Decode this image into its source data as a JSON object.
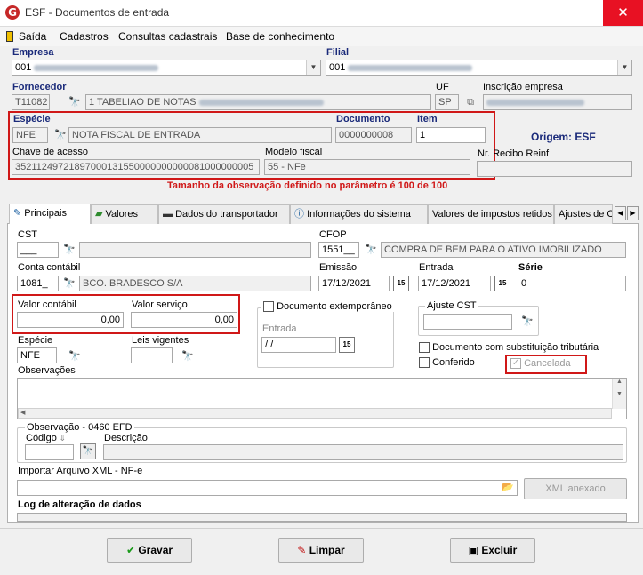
{
  "window": {
    "title": "ESF - Documentos de entrada",
    "close": "✕"
  },
  "menu": [
    "Saída",
    "Cadastros",
    "Consultas cadastrais",
    "Base de conhecimento"
  ],
  "header": {
    "empresa_label": "Empresa",
    "empresa_code": "001",
    "filial_label": "Filial",
    "filial_code": "001",
    "fornecedor_label": "Fornecedor",
    "fornecedor_code": "T11082",
    "fornecedor_name": "1 TABELIAO DE NOTAS",
    "uf_label": "UF",
    "uf_value": "SP",
    "inscricao_label": "Inscrição empresa",
    "especie_label": "Espécie",
    "especie_code": "NFE",
    "especie_name": "NOTA FISCAL DE ENTRADA",
    "documento_label": "Documento",
    "documento_value": "0000000008",
    "item_label": "Item",
    "item_value": "1",
    "origem": "Origem: ESF",
    "chave_label": "Chave de acesso",
    "chave_value": "35211249721897000131550000000000081000000005",
    "modelo_label": "Modelo fiscal",
    "modelo_value": "55 - NFe",
    "recibo_label": "Nr. Recibo Reinf",
    "obs_warning": "Tamanho da observação definido no parâmetro é 100 de 100"
  },
  "tabs": [
    "Principais",
    "Valores",
    "Dados do transportador",
    "Informações do sistema",
    "Valores de impostos retidos",
    "Ajustes de C"
  ],
  "main": {
    "cst_label": "CST",
    "cst_value": "___",
    "cfop_label": "CFOP",
    "cfop_code": "1551__",
    "cfop_desc": "COMPRA DE BEM PARA O ATIVO IMOBILIZADO",
    "conta_label": "Conta contábil",
    "conta_code": "1081_",
    "conta_desc": "BCO. BRADESCO S/A",
    "emissao_label": "Emissão",
    "emissao_value": "17/12/2021",
    "entrada_label": "Entrada",
    "entrada_value": "17/12/2021",
    "serie_label": "Série",
    "serie_value": "0",
    "valor_contabil_label": "Valor contábil",
    "valor_contabil_value": "0,00",
    "valor_servico_label": "Valor serviço",
    "valor_servico_value": "0,00",
    "doc_extemp_label": "Documento extemporâneo",
    "doc_extemp_entrada_label": "Entrada",
    "doc_extemp_entrada_value": " / /",
    "ajuste_cst_label": "Ajuste CST",
    "especie2_label": "Espécie",
    "especie2_value": "NFE",
    "leis_label": "Leis vigentes",
    "subst_label": "Documento com substituição tributária",
    "conferido_label": "Conferido",
    "cancelada_label": "Cancelada",
    "obs_label": "Observações",
    "obs0460_label": "Observação - 0460 EFD",
    "codigo_label": "Código",
    "descricao_label": "Descrição",
    "importar_label": "Importar Arquivo XML - NF-e",
    "xml_anexado": "XML anexado",
    "log_label": "Log de alteração de dados"
  },
  "buttons": {
    "gravar": "Gravar",
    "limpar": "Limpar",
    "excluir": "Excluir"
  }
}
